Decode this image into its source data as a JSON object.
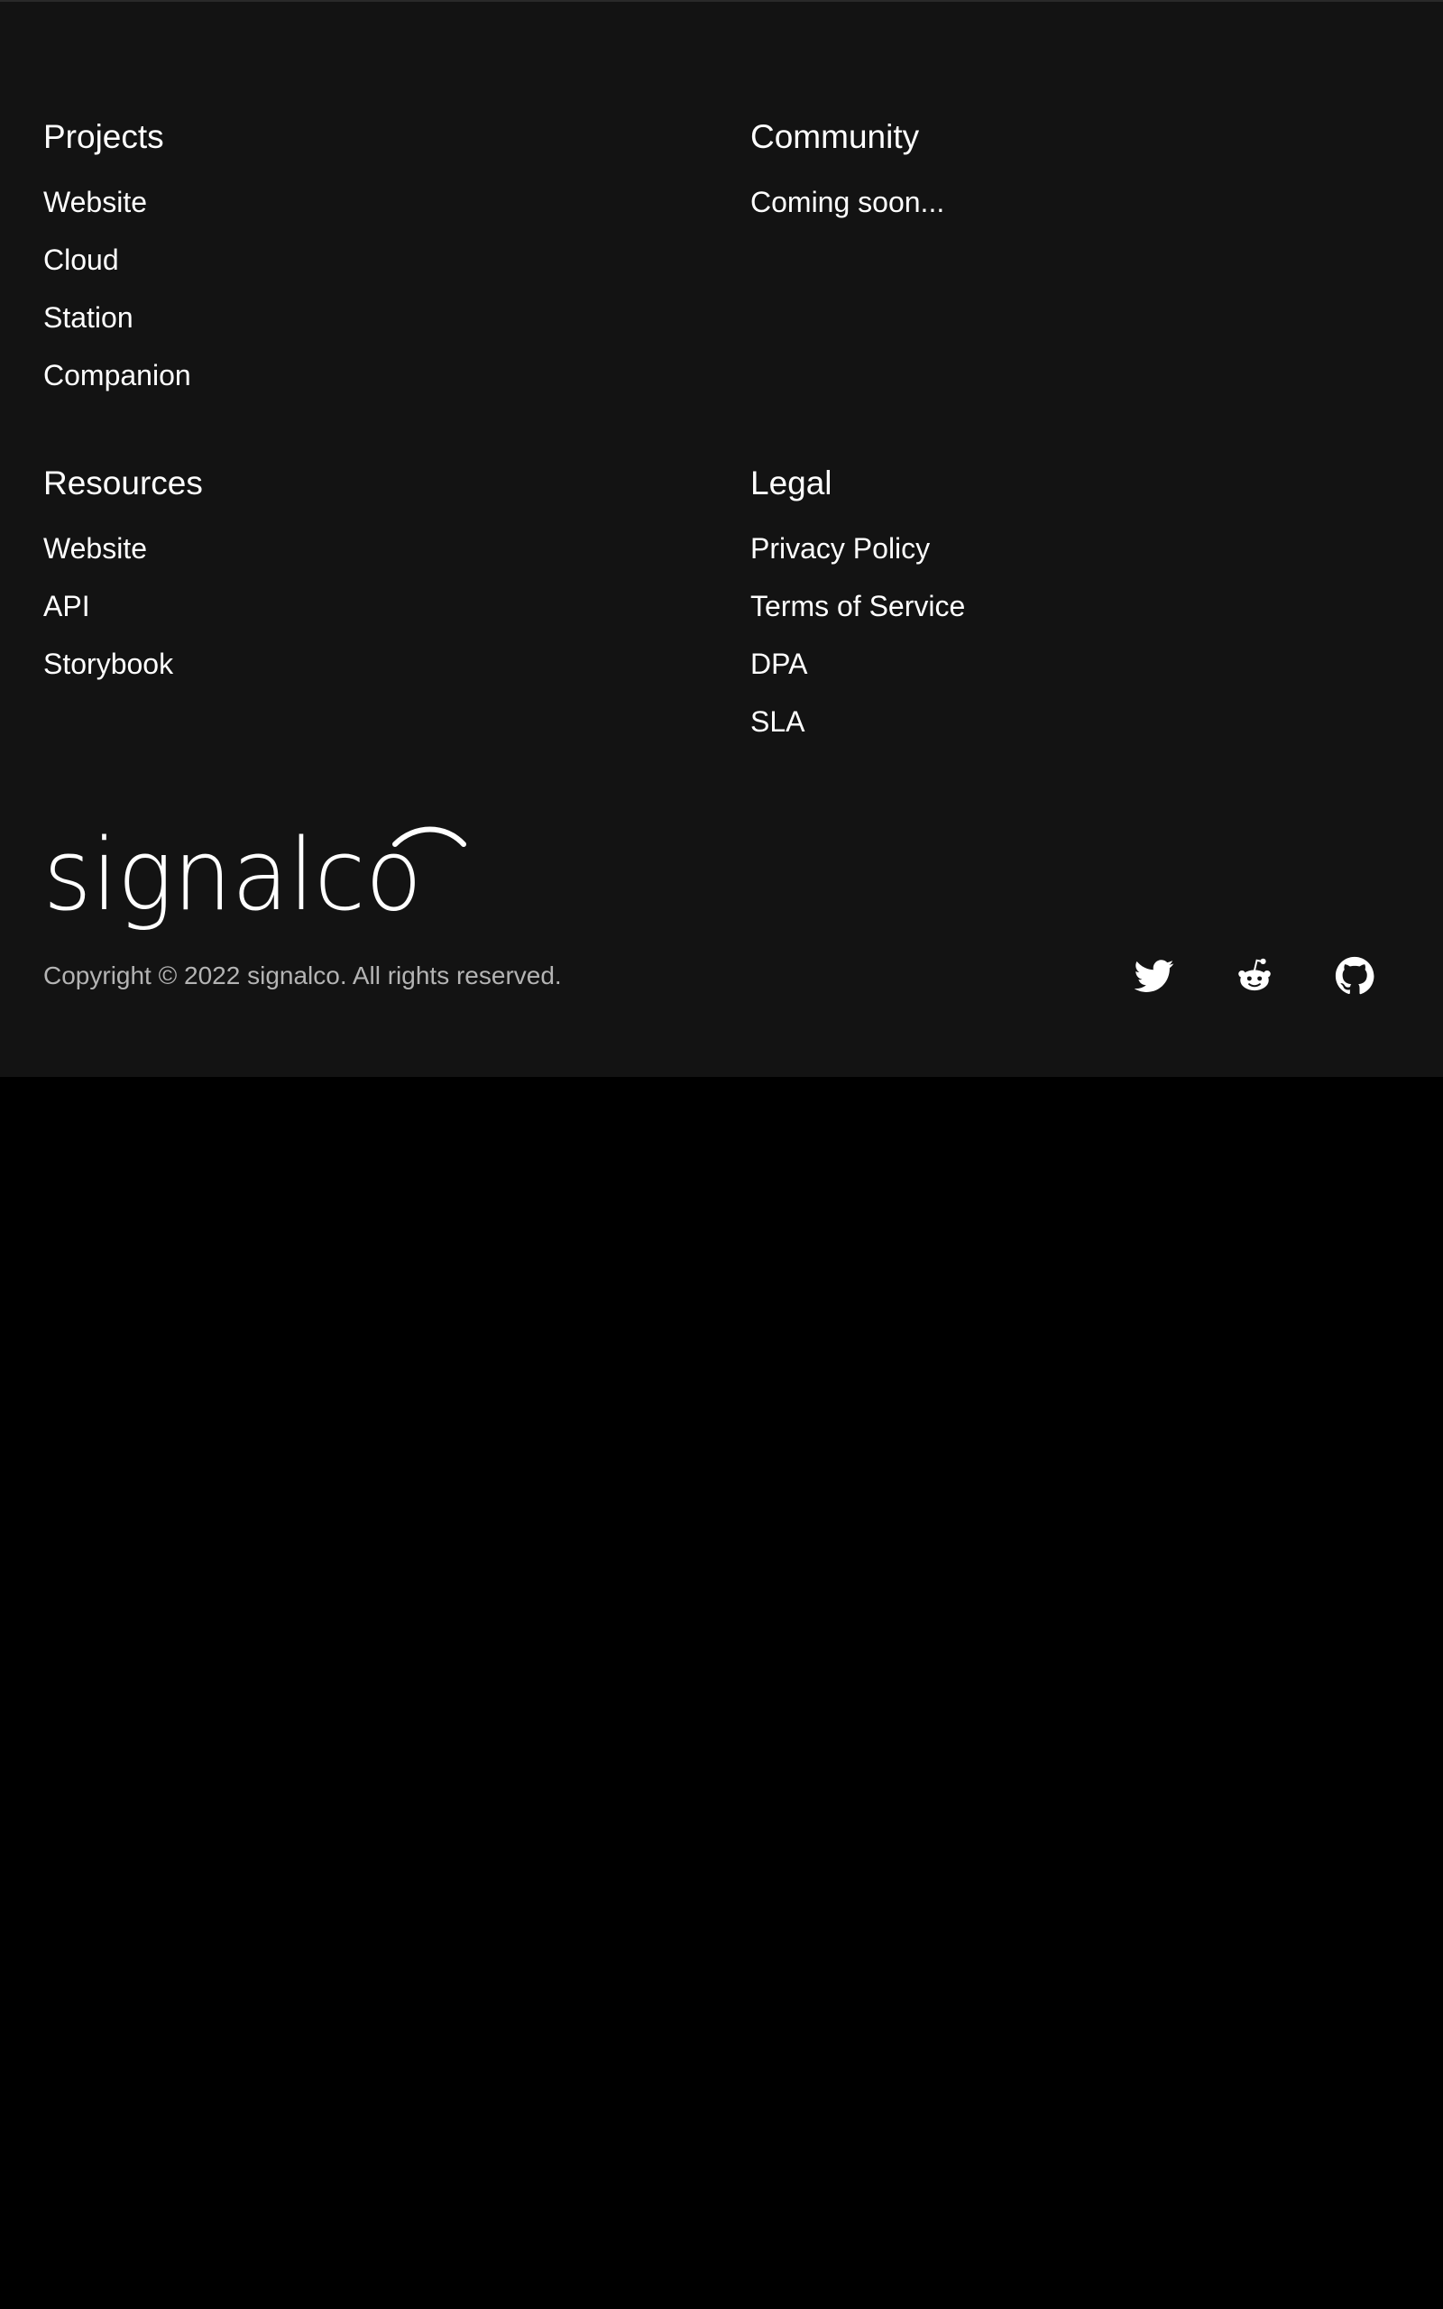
{
  "footer": {
    "projects": {
      "heading": "Projects",
      "items": [
        {
          "label": "Website"
        },
        {
          "label": "Cloud"
        },
        {
          "label": "Station"
        },
        {
          "label": "Companion"
        }
      ]
    },
    "community": {
      "heading": "Community",
      "text": "Coming soon..."
    },
    "resources": {
      "heading": "Resources",
      "items": [
        {
          "label": "Website"
        },
        {
          "label": "API"
        },
        {
          "label": "Storybook"
        }
      ]
    },
    "legal": {
      "heading": "Legal",
      "items": [
        {
          "label": "Privacy Policy"
        },
        {
          "label": "Terms of Service"
        },
        {
          "label": "DPA"
        },
        {
          "label": "SLA"
        }
      ]
    },
    "logo_text": "signalco",
    "copyright": "Copyright © 2022 signalco. All rights reserved.",
    "social": [
      {
        "icon": "twitter-icon"
      },
      {
        "icon": "reddit-icon"
      },
      {
        "icon": "github-icon"
      }
    ]
  },
  "colors": {
    "footer_background": "#131313",
    "page_background": "#000000",
    "text": "#ffffff",
    "muted_text": "#b4b4b4"
  }
}
